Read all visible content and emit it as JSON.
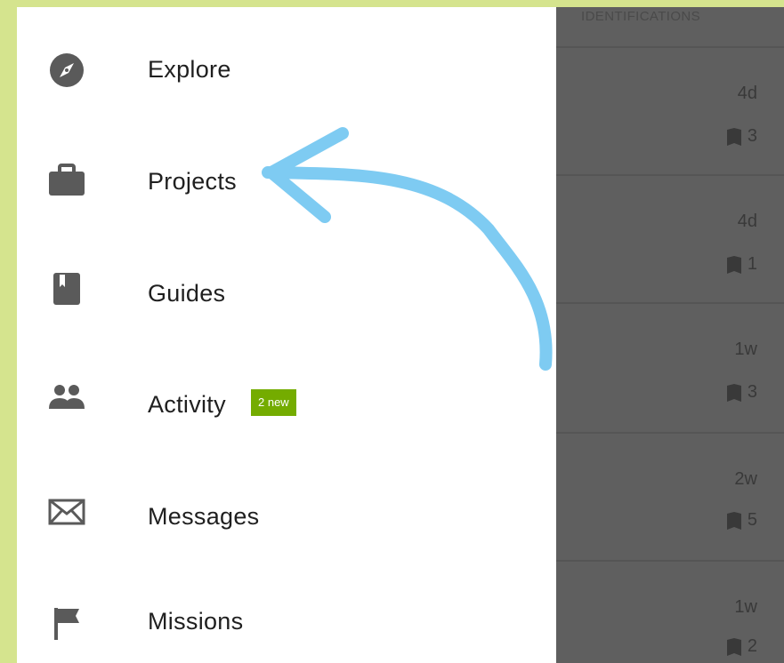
{
  "menu": {
    "items": [
      {
        "label": "Explore",
        "icon": "compass-icon"
      },
      {
        "label": "Projects",
        "icon": "briefcase-icon"
      },
      {
        "label": "Guides",
        "icon": "book-icon"
      },
      {
        "label": "Activity",
        "icon": "people-icon",
        "badge": "2 new"
      },
      {
        "label": "Messages",
        "icon": "envelope-icon"
      },
      {
        "label": "Missions",
        "icon": "flag-icon"
      }
    ]
  },
  "observations": {
    "header": "IDENTIFICATIONS",
    "rows": [
      {
        "time": "4d",
        "count": "3"
      },
      {
        "time": "4d",
        "count": "1"
      },
      {
        "time": "1w",
        "count": "3"
      },
      {
        "time": "2w",
        "count": "5"
      },
      {
        "time": "1w",
        "count": "2"
      }
    ]
  },
  "colors": {
    "background": "#d5e48e",
    "badge": "#74ac00",
    "overlay": "#5f5f5f",
    "icon": "#5a5a5a",
    "annotation_arrow": "#7ecbf2"
  }
}
